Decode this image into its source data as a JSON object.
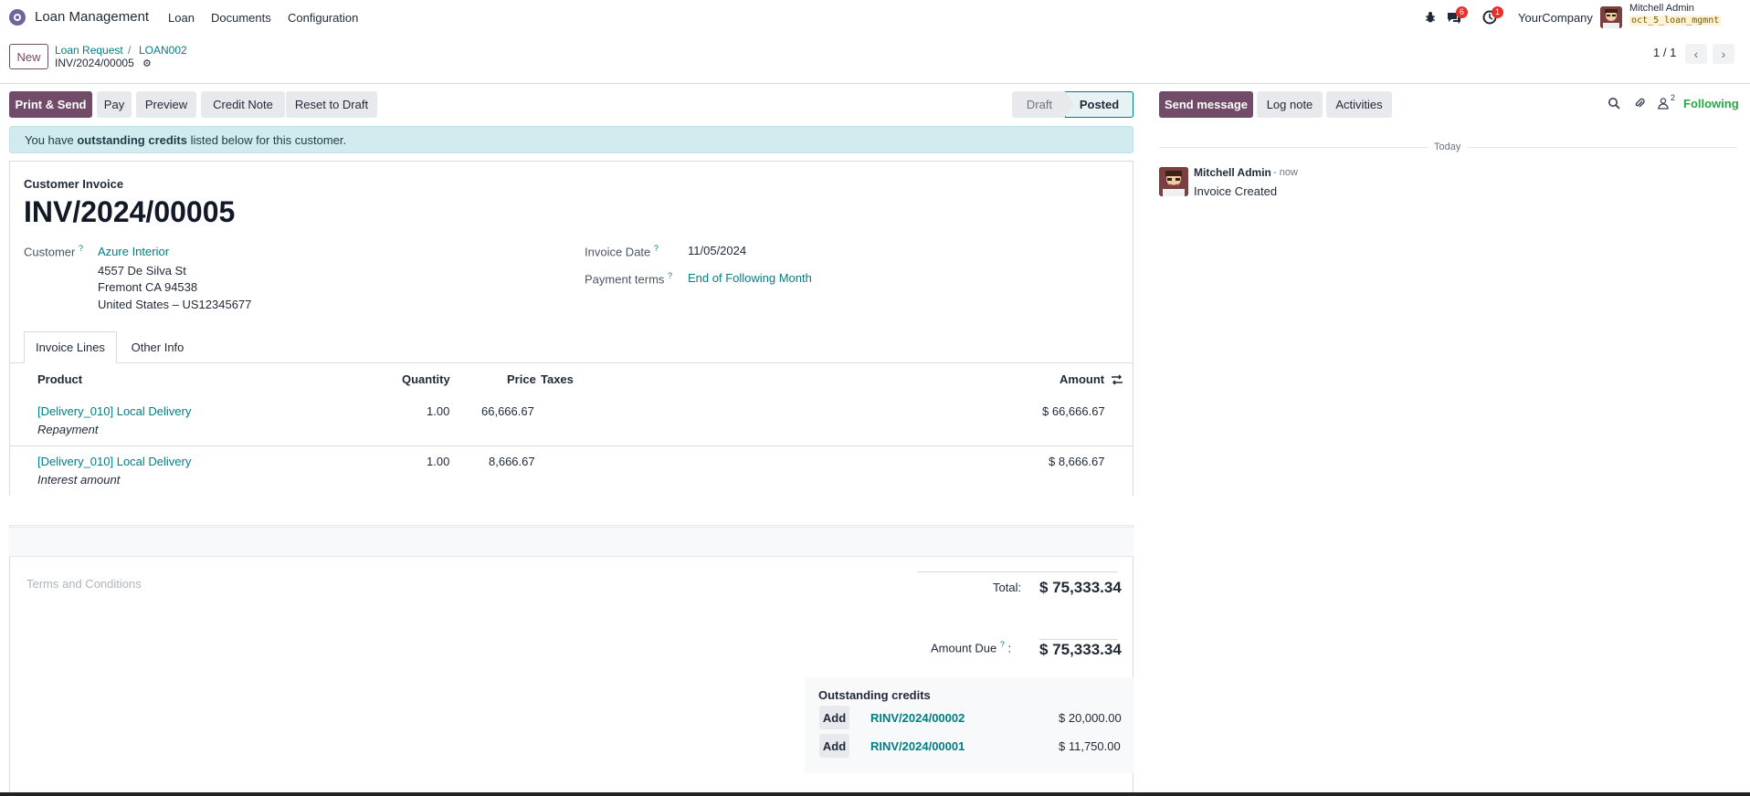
{
  "navbar": {
    "app_name": "Loan Management",
    "menu": [
      "Loan",
      "Documents",
      "Configuration"
    ],
    "messages_count": "6",
    "activities_count": "1",
    "company": "YourCompany",
    "user_name": "Mitchell Admin",
    "db_name": "oct_5_loan_mgmnt"
  },
  "control_panel": {
    "new_label": "New",
    "breadcrumb": [
      "Loan Request",
      "LOAN002"
    ],
    "breadcrumb_sep": "/",
    "record_name": "INV/2024/00005",
    "pager": "1 / 1"
  },
  "actions": {
    "print_send": "Print & Send",
    "pay": "Pay",
    "preview": "Preview",
    "credit_note": "Credit Note",
    "reset_draft": "Reset to Draft"
  },
  "statusbar": {
    "draft": "Draft",
    "posted": "Posted"
  },
  "alert": {
    "before": "You have ",
    "bold": "outstanding credits",
    "after": " listed below for this customer."
  },
  "invoice": {
    "type": "Customer Invoice",
    "name": "INV/2024/00005",
    "customer_label": "Customer",
    "customer": "Azure Interior",
    "address": [
      "4557 De Silva St",
      "Fremont CA 94538",
      "United States – US12345677"
    ],
    "invoice_date_label": "Invoice Date",
    "invoice_date": "11/05/2024",
    "payment_terms_label": "Payment terms",
    "payment_terms": "End of Following Month"
  },
  "tabs": [
    "Invoice Lines",
    "Other Info"
  ],
  "lines": {
    "headers": {
      "product": "Product",
      "quantity": "Quantity",
      "price": "Price",
      "taxes": "Taxes",
      "amount": "Amount"
    },
    "rows": [
      {
        "product": "[Delivery_010] Local Delivery",
        "label": "Repayment",
        "quantity": "1.00",
        "price": "66,666.67",
        "amount": "$ 66,666.67"
      },
      {
        "product": "[Delivery_010] Local Delivery",
        "label": "Interest amount",
        "quantity": "1.00",
        "price": "8,666.67",
        "amount": "$ 8,666.67"
      }
    ]
  },
  "terms_placeholder": "Terms and Conditions",
  "totals": {
    "total_label": "Total:",
    "total": "$ 75,333.34",
    "amount_due_label": "Amount Due",
    "amount_due": "$ 75,333.34"
  },
  "outstanding": {
    "title": "Outstanding credits",
    "add_label": "Add",
    "items": [
      {
        "ref": "RINV/2024/00002",
        "amount": "$ 20,000.00"
      },
      {
        "ref": "RINV/2024/00001",
        "amount": "$ 11,750.00"
      }
    ]
  },
  "chatter": {
    "send_message": "Send message",
    "log_note": "Log note",
    "activities": "Activities",
    "followers_count": "2",
    "following": "Following",
    "date_separator": "Today",
    "message": {
      "author": "Mitchell Admin",
      "time": "- now",
      "body": "Invoice Created"
    }
  },
  "colors": {
    "primary": "#714b67",
    "link": "#017e84",
    "following": "#28a745",
    "alert_bg": "#d2ebef"
  }
}
